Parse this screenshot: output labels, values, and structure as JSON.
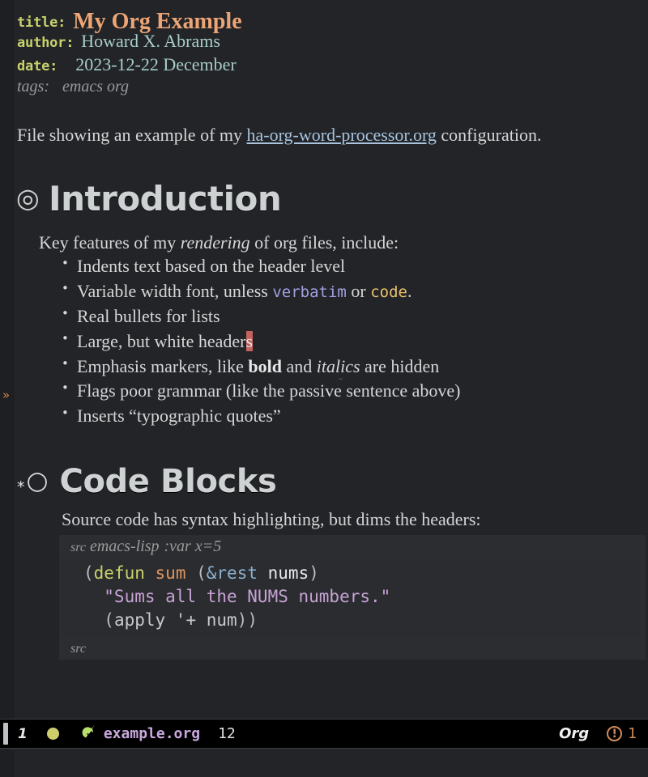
{
  "document": {
    "keywords": [
      {
        "key": "title:",
        "value": "My Org Example"
      },
      {
        "key": "author:",
        "value": "Howard X. Abrams"
      },
      {
        "key": "date:",
        "value": "2023-12-22 December"
      }
    ],
    "tags_label": "tags:",
    "tags_value": "emacs org",
    "intro": {
      "before_link": "File showing an example of my ",
      "link_text": "ha-org-word-processor.org",
      "after_link": " configuration."
    },
    "sections": [
      {
        "bullet": "◎",
        "stars": "",
        "title": "Introduction",
        "lead": {
          "before_em": "Key features of my ",
          "em": "rendering",
          "after_em": " of org files, include:"
        },
        "bullets": [
          {
            "text": "Indents text based on the header level"
          },
          {
            "prefix": "Variable width font, unless ",
            "verbatim": "verbatim",
            "middle": " or ",
            "code": "code",
            "suffix": "."
          },
          {
            "text": "Real bullets for lists"
          },
          {
            "prefix": "Large, but white header",
            "cursor_char": "s"
          },
          {
            "prefix": "Emphasis markers, like ",
            "bold": "bold",
            "middle": " and ",
            "italic": "italics",
            "suffix": " are hidden"
          },
          {
            "text": "Flags poor grammar (like the passive sentence above)"
          },
          {
            "text": "Inserts “typographic quotes”"
          }
        ]
      },
      {
        "bullet": "○",
        "stars": "*",
        "title": "Code Blocks",
        "lead_plain": "Source code has syntax highlighting, but dims the headers:"
      }
    ],
    "source_block": {
      "begin_keyword": "src",
      "language": "emacs-lisp",
      "args": ":var x=5",
      "end_keyword": "src",
      "lines": [
        [
          {
            "t": "(",
            "c": "paren"
          },
          {
            "t": "defun",
            "c": "keyword"
          },
          {
            "t": " ",
            "c": "plain"
          },
          {
            "t": "sum",
            "c": "fn"
          },
          {
            "t": " (",
            "c": "paren"
          },
          {
            "t": "&rest",
            "c": "amp"
          },
          {
            "t": " ",
            "c": "plain"
          },
          {
            "t": "nums",
            "c": "var"
          },
          {
            "t": ")",
            "c": "paren"
          }
        ],
        [
          {
            "t": "  \"Sums all the NUMS numbers.\"",
            "c": "string"
          }
        ],
        [
          {
            "t": "  (",
            "c": "paren"
          },
          {
            "t": "apply",
            "c": "plain"
          },
          {
            "t": " '+ ",
            "c": "plain"
          },
          {
            "t": "num",
            "c": "plain"
          },
          {
            "t": "))",
            "c": "paren"
          }
        ]
      ]
    },
    "fringe_indicator": "»"
  },
  "mode_line": {
    "window_number": "1",
    "status_dot_color": "#cdd06a",
    "project_icon": "🦄",
    "buffer_name": "example.org",
    "position": "12",
    "major_mode": "Org",
    "warning_icon": "!",
    "warning_count": "1"
  },
  "colors": {
    "background": "#222428",
    "fringe": "#1d1f23",
    "title_accent": "#eda575",
    "keyword": "#c9d16b",
    "meta_value": "#a8ccc8",
    "link": "#a8c3dd",
    "heading": "#cfd2d2",
    "verbatim": "#a39ee0",
    "code": "#e8c06a",
    "string": "#c7a3d4",
    "cursor": "#c4625f",
    "mode_line_bg": "#000000",
    "buffer_name": "#c8a8dd",
    "warning": "#d08b5a"
  }
}
